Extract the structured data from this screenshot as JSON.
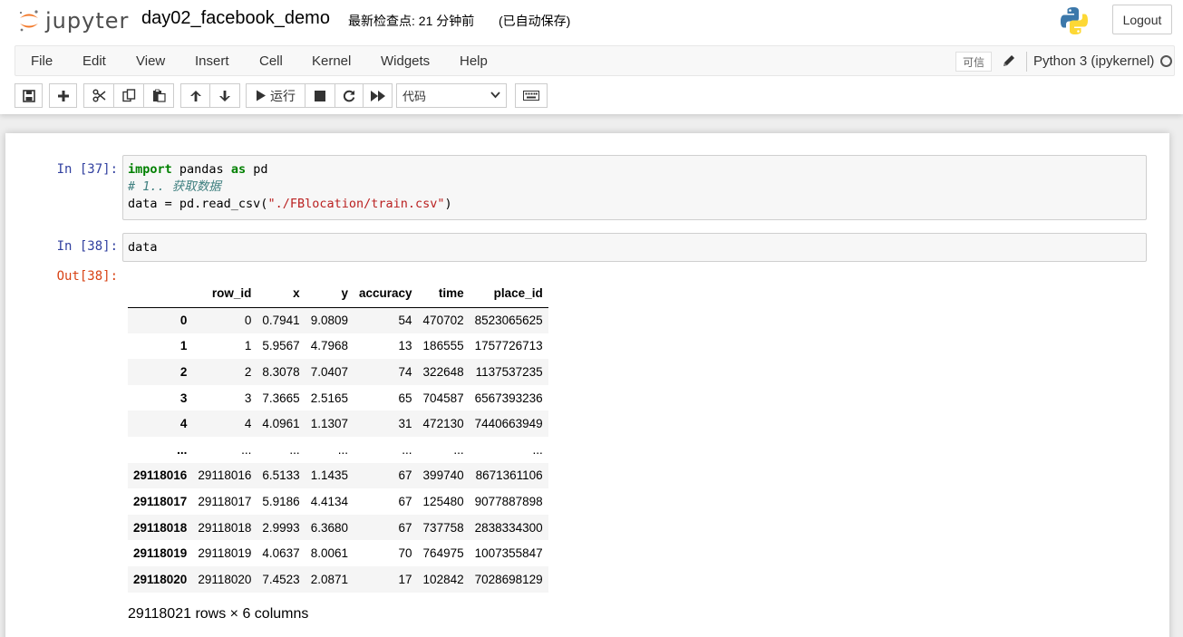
{
  "header": {
    "logo_text": "jupyter",
    "notebook_name": "day02_facebook_demo",
    "checkpoint": "最新检查点: 21 分钟前",
    "autosave": "(已自动保存)",
    "logout_label": "Logout"
  },
  "menubar": {
    "items": [
      "File",
      "Edit",
      "View",
      "Insert",
      "Cell",
      "Kernel",
      "Widgets",
      "Help"
    ],
    "trusted_label": "可信",
    "kernel_name": "Python 3 (ipykernel)"
  },
  "toolbar": {
    "run_label": "运行",
    "cell_type": "代码"
  },
  "cells": [
    {
      "prompt": "In  [37]:",
      "code": {
        "line1_kw1": "import",
        "line1_mid": " pandas ",
        "line1_kw2": "as",
        "line1_end": " pd",
        "line2_comment": "# 1.. 获取数据",
        "line3_start": "data = pd.read_csv(",
        "line3_string": "\"./FBlocation/train.csv\"",
        "line3_end": ")"
      }
    },
    {
      "prompt": "In  [38]:",
      "code_text": "data",
      "out_prompt": "Out[38]:"
    }
  ],
  "dataframe": {
    "columns": [
      "",
      "row_id",
      "x",
      "y",
      "accuracy",
      "time",
      "place_id"
    ],
    "rows": [
      [
        "0",
        "0",
        "0.7941",
        "9.0809",
        "54",
        "470702",
        "8523065625"
      ],
      [
        "1",
        "1",
        "5.9567",
        "4.7968",
        "13",
        "186555",
        "1757726713"
      ],
      [
        "2",
        "2",
        "8.3078",
        "7.0407",
        "74",
        "322648",
        "1137537235"
      ],
      [
        "3",
        "3",
        "7.3665",
        "2.5165",
        "65",
        "704587",
        "6567393236"
      ],
      [
        "4",
        "4",
        "4.0961",
        "1.1307",
        "31",
        "472130",
        "7440663949"
      ],
      [
        "...",
        "...",
        "...",
        "...",
        "...",
        "...",
        "..."
      ],
      [
        "29118016",
        "29118016",
        "6.5133",
        "1.1435",
        "67",
        "399740",
        "8671361106"
      ],
      [
        "29118017",
        "29118017",
        "5.9186",
        "4.4134",
        "67",
        "125480",
        "9077887898"
      ],
      [
        "29118018",
        "29118018",
        "2.9993",
        "6.3680",
        "67",
        "737758",
        "2838334300"
      ],
      [
        "29118019",
        "29118019",
        "4.0637",
        "8.0061",
        "70",
        "764975",
        "1007355847"
      ],
      [
        "29118020",
        "29118020",
        "7.4523",
        "2.0871",
        "17",
        "102842",
        "7028698129"
      ]
    ],
    "shape_text": "29118021 rows × 6 columns"
  }
}
